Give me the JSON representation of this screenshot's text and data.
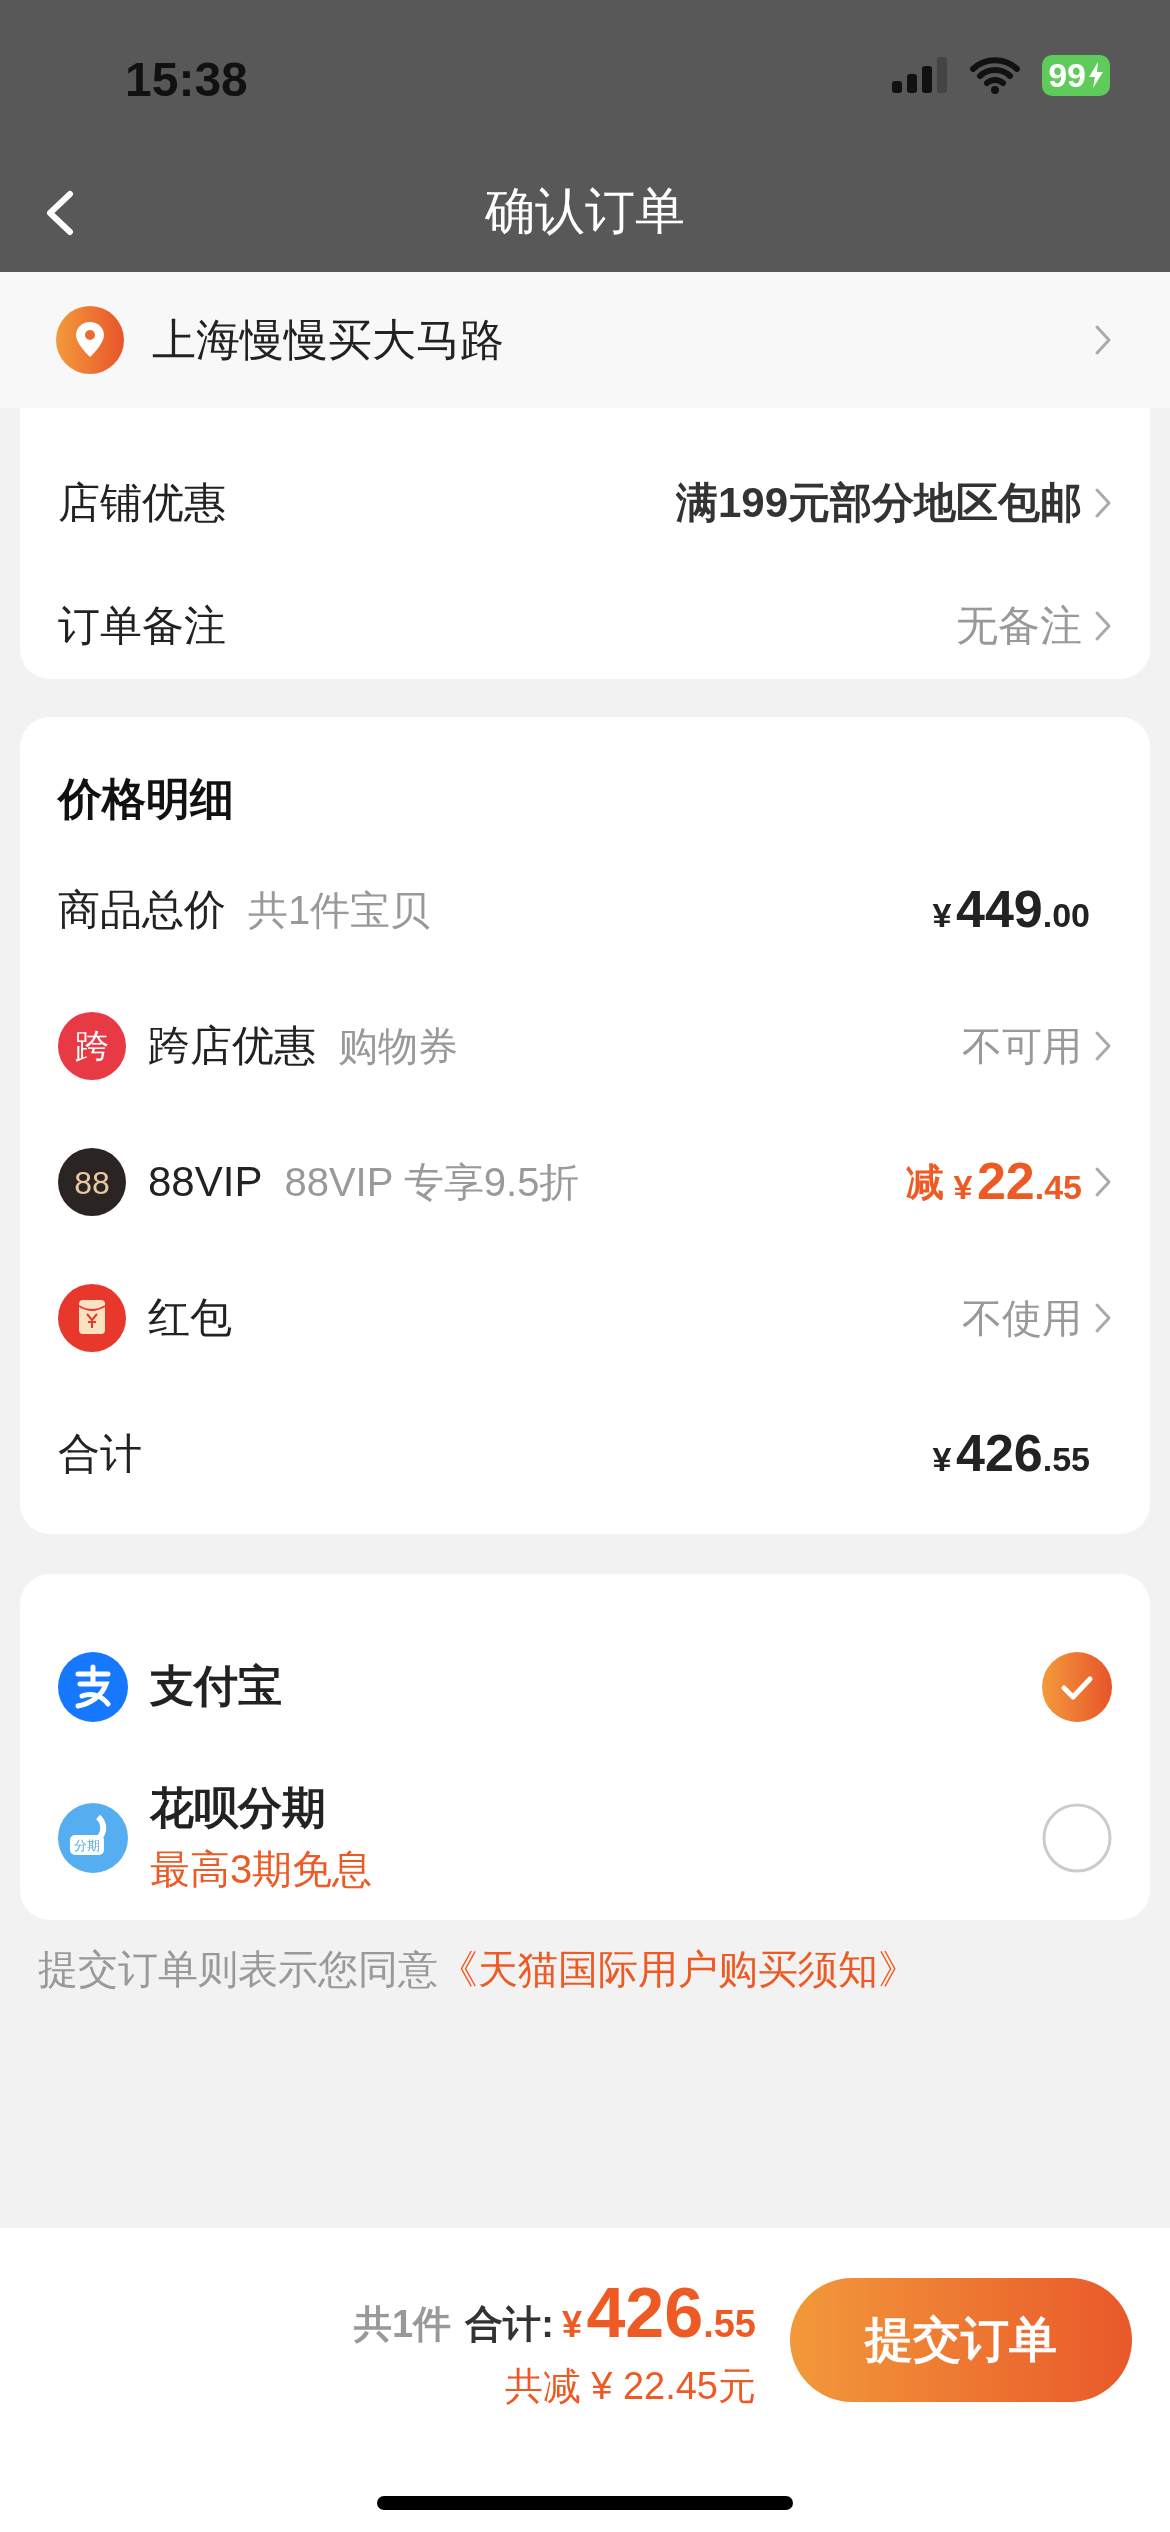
{
  "status_bar": {
    "time": "15:38",
    "battery": "99"
  },
  "nav": {
    "title": "确认订单"
  },
  "address": {
    "text": "上海慢慢买大马路"
  },
  "order_options": [
    {
      "label": "店铺优惠",
      "value": "满199元部分地区包邮"
    },
    {
      "label": "订单备注",
      "value": "无备注"
    }
  ],
  "price_details": {
    "title": "价格明细",
    "rows": [
      {
        "kind": "price",
        "label": "商品总价",
        "note": "共1件宝贝",
        "price": {
          "symbol": "¥",
          "integer": "449",
          "decimal": ".00"
        }
      },
      {
        "kind": "link",
        "icon_text": "跨",
        "label": "跨店优惠",
        "note": "购物券",
        "value": "不可用"
      },
      {
        "kind": "discount",
        "icon_text": "88",
        "label": "88VIP",
        "note": "88VIP 专享9.5折",
        "prefix": "减",
        "price": {
          "symbol": "¥",
          "integer": "22",
          "decimal": ".45"
        }
      },
      {
        "kind": "link",
        "label": "红包",
        "value": "不使用"
      },
      {
        "kind": "price",
        "label": "合计",
        "price": {
          "symbol": "¥",
          "integer": "426",
          "decimal": ".55"
        }
      }
    ]
  },
  "payment_methods": [
    {
      "name": "支付宝",
      "selected": true
    },
    {
      "icon_text": "分期",
      "name": "花呗分期",
      "subtitle": "最高3期免息",
      "selected": false
    }
  ],
  "terms": {
    "text": "提交订单则表示您同意",
    "link": "《天猫国际用户购买须知》"
  },
  "footer": {
    "count": "共1件",
    "total_label": "合计:",
    "total": {
      "symbol": "¥",
      "integer": "426",
      "decimal": ".55"
    },
    "savings": "共减 ¥ 22.45元",
    "submit": "提交订单"
  }
}
